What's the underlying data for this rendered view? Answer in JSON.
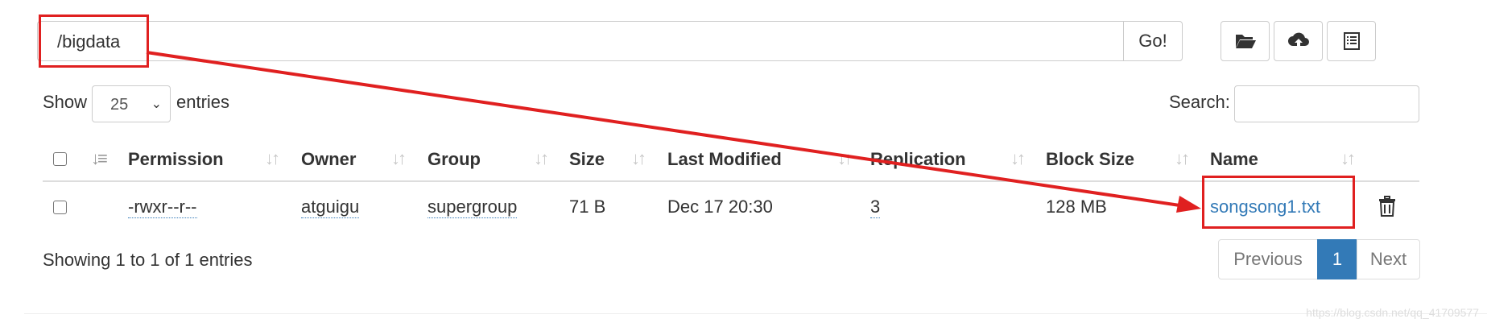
{
  "path_bar": {
    "value": "/bigdata",
    "go_label": "Go!"
  },
  "toolbar": {
    "icons": [
      "folder-open-icon",
      "cloud-upload-icon",
      "list-icon"
    ]
  },
  "length_menu": {
    "show_label": "Show",
    "page_size": "25",
    "entries_label": "entries"
  },
  "search": {
    "label": "Search:",
    "value": ""
  },
  "table": {
    "columns": [
      "Permission",
      "Owner",
      "Group",
      "Size",
      "Last Modified",
      "Replication",
      "Block Size",
      "Name"
    ],
    "rows": [
      {
        "permission": "-rwxr--r--",
        "owner": "atguigu",
        "group": "supergroup",
        "size": "71 B",
        "last_modified": "Dec 17 20:30",
        "replication": "3",
        "block_size": "128 MB",
        "name": "songsong1.txt"
      }
    ]
  },
  "info": "Showing 1 to 1 of 1 entries",
  "pagination": {
    "previous": "Previous",
    "current": "1",
    "next": "Next"
  },
  "watermark": "https://blog.csdn.net/qq_41709577",
  "colors": {
    "link": "#337ab7",
    "annotation": "#e02020",
    "border": "#cccccc"
  }
}
